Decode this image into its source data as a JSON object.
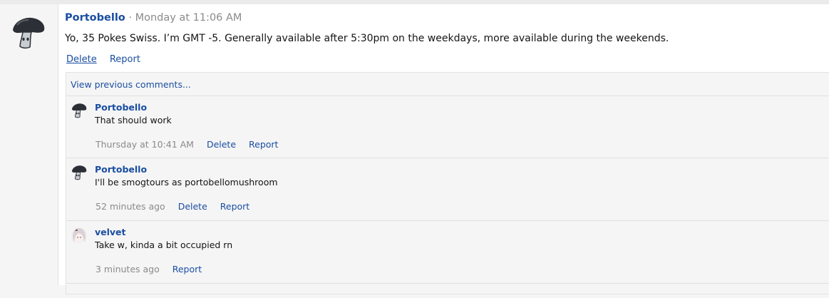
{
  "post": {
    "author": "Portobello",
    "separator": "·",
    "time": "Monday at 11:06 AM",
    "body": "Yo, 35 Pokes Swiss. I’m GMT -5. Generally available after 5:30pm on the weekdays, more available during the weekends.",
    "actions": {
      "delete": "Delete",
      "report": "Report"
    }
  },
  "comments": {
    "view_previous": "View previous comments...",
    "items": [
      {
        "author": "Portobello",
        "text": "That should work",
        "time": "Thursday at 10:41 AM",
        "delete": "Delete",
        "report": "Report"
      },
      {
        "author": "Portobello",
        "text": "I'll be smogtours as portobellomushroom",
        "time": "52 minutes ago",
        "delete": "Delete",
        "report": "Report"
      },
      {
        "author": "velvet",
        "text": "Take w, kinda a bit occupied rn",
        "time": "3 minutes ago",
        "report": "Report"
      }
    ]
  },
  "colors": {
    "link": "#1a4ea1",
    "muted": "#8a8a8a",
    "avatar_mushroom": "#2c3036"
  },
  "icons": {
    "author_avatar": "mushroom-avatar",
    "velvet_avatar": "anime-girl-avatar"
  }
}
